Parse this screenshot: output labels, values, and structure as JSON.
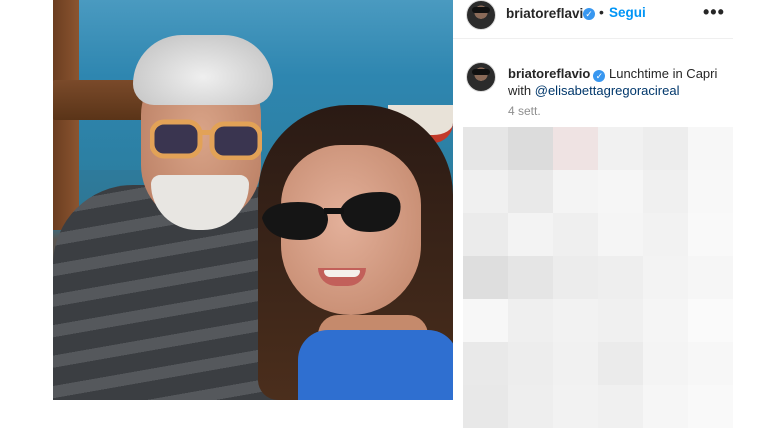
{
  "post": {
    "author": "briatoreflavio",
    "verified_icon": "verified-badge-icon",
    "separator": "•",
    "follow_label": "Segui",
    "more_icon": "more-options-icon",
    "more_glyph": "•••",
    "caption_text": "Lunchtime in Capri",
    "caption_with": "with",
    "caption_mention": "@elisabettagregoracireal",
    "time_ago": "4 sett.",
    "photo_description_icon": "post-photo"
  },
  "colors": {
    "accent": "#0095f6",
    "verified": "#3897f0",
    "mention": "#00376b",
    "muted": "#8e8e8e"
  },
  "comments_placeholder_tiles": [
    "#e6e6e6",
    "#dcdcdc",
    "#efe3e3",
    "#f1f1f1",
    "#ededed",
    "#f7f7f7",
    "#f0f0f0",
    "#e9e9e9",
    "#f4f4f4",
    "#f6f6f6",
    "#f0f0f0",
    "#f8f8f8",
    "#ebebeb",
    "#f3f3f3",
    "#efefef",
    "#f5f5f5",
    "#f2f2f2",
    "#f9f9f9",
    "#dedede",
    "#e5e5e5",
    "#ececec",
    "#eeeeee",
    "#f3f3f3",
    "#f6f6f6",
    "#f7f7f7",
    "#efefef",
    "#f2f2f2",
    "#f0f0f0",
    "#f5f5f5",
    "#fafafa",
    "#e9e9e9",
    "#ededed",
    "#f1f1f1",
    "#ebebeb",
    "#f4f4f4",
    "#f7f7f7",
    "#e8e8e8",
    "#eeeeee",
    "#f2f2f2",
    "#f0f0f0",
    "#f6f6f6",
    "#f9f9f9"
  ]
}
